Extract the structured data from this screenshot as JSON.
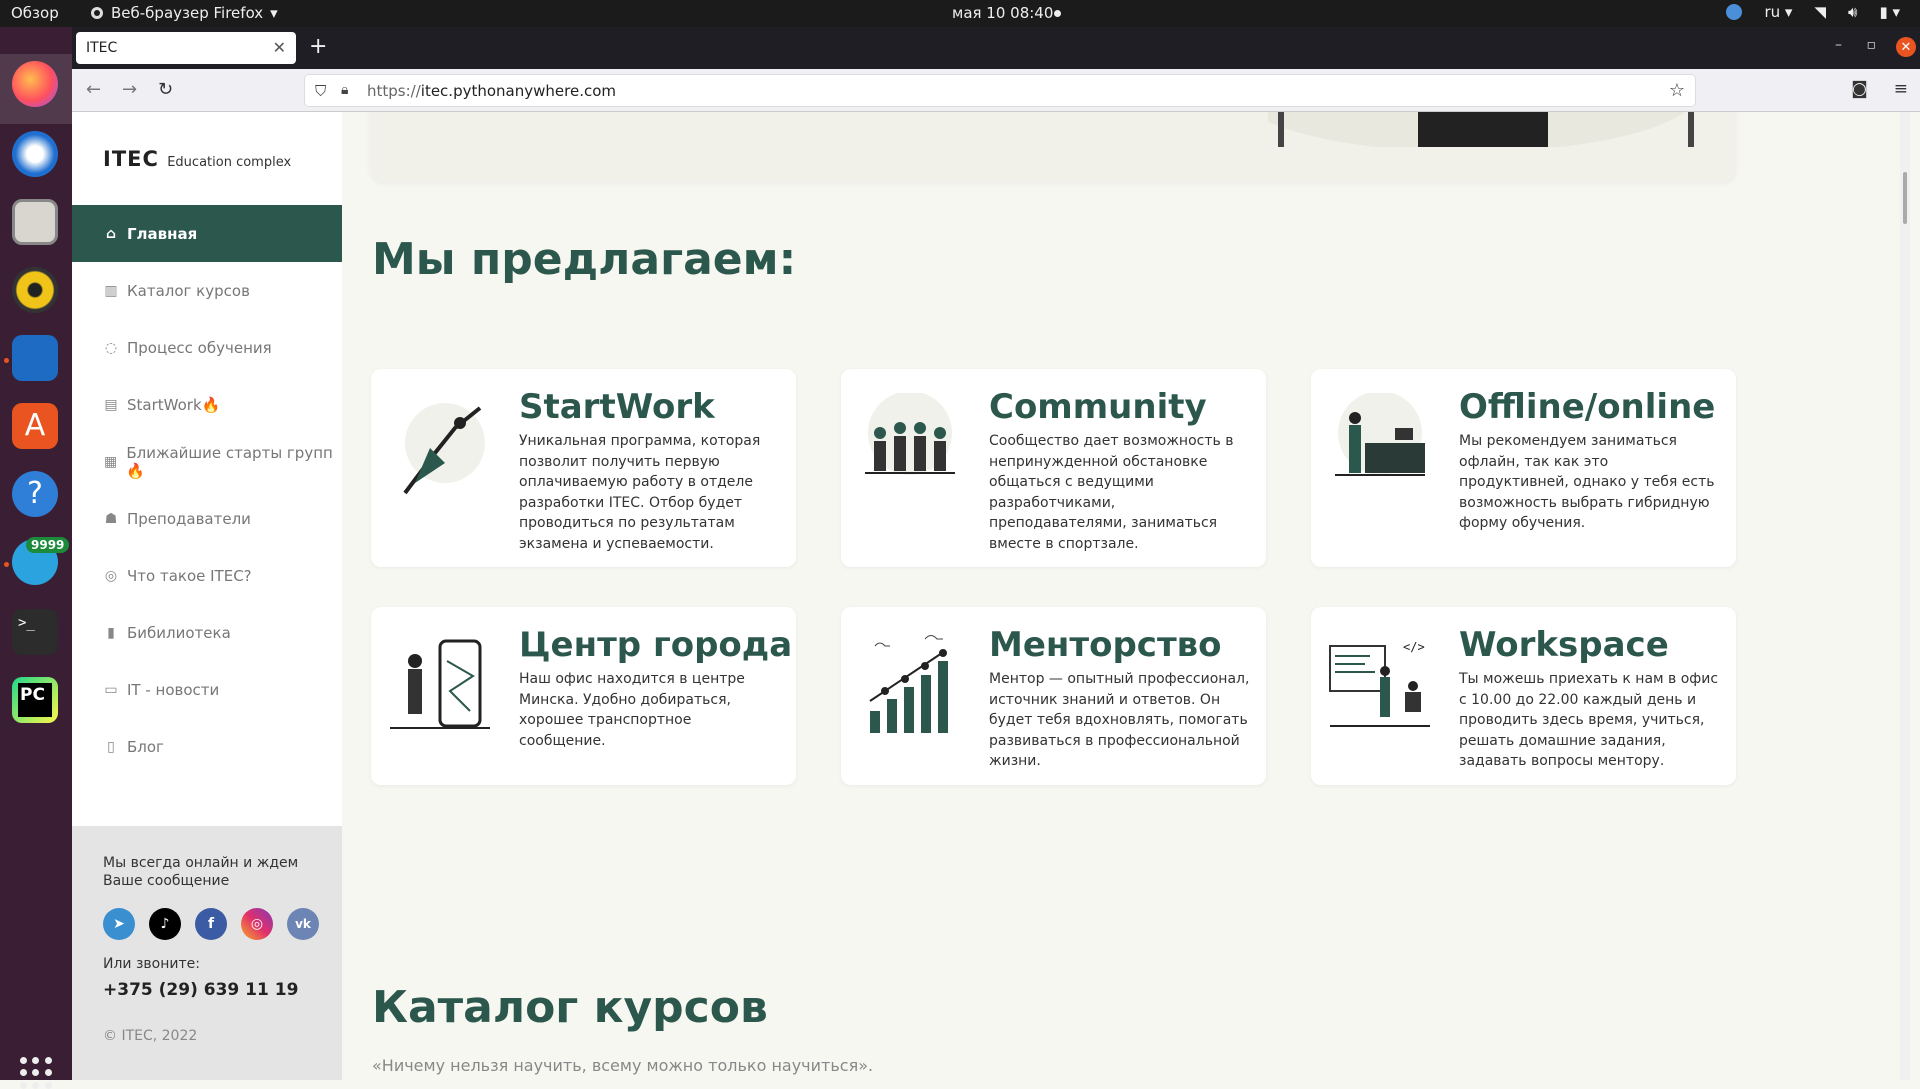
{
  "system": {
    "activities": "Обзор",
    "app_name": "Веб-браузер Firefox",
    "clock": "мая 10  08:40",
    "lang": "ru",
    "telegram_badge": "9999"
  },
  "browser": {
    "tab_title": "ITEC",
    "url_scheme": "https://",
    "url_host": "itec.pythonanywhere.com"
  },
  "sidebar": {
    "logo": "ITEC",
    "logo_sub": "Education complex",
    "items": [
      {
        "label": "Главная",
        "icon": "home-icon"
      },
      {
        "label": "Каталог курсов",
        "icon": "book-icon"
      },
      {
        "label": "Процесс обучения",
        "icon": "cycle-icon"
      },
      {
        "label": "StartWork🔥",
        "icon": "briefcase-icon"
      },
      {
        "label": "Ближайшие старты групп🔥",
        "icon": "calendar-icon"
      },
      {
        "label": "Преподаватели",
        "icon": "people-icon"
      },
      {
        "label": "Что такое ITEC?",
        "icon": "question-icon"
      },
      {
        "label": "Бибилиотека",
        "icon": "library-icon"
      },
      {
        "label": "IT - новости",
        "icon": "news-icon"
      },
      {
        "label": "Блог",
        "icon": "blog-icon"
      }
    ],
    "contact_text": "Мы всегда онлайн и ждем Ваше сообщение",
    "phone_label": "Или звоните:",
    "phone": "+375 (29) 639 11 19",
    "copyright": "© ITEC, 2022"
  },
  "main": {
    "offer_title": "Мы предлагаем:",
    "cards": [
      {
        "title": "StartWork",
        "text": "Уникальная программа, которая позволит получить первую оплачиваемую работу в отделе разработки ITEC. Отбор будет проводиться по результатам экзамена и успеваемости."
      },
      {
        "title": "Community",
        "text": "Сообщество дает возможность в непринужденной обстановке общаться с ведущими разработчиками, преподавателями, заниматься вместе в спортзале."
      },
      {
        "title": "Offline/online",
        "text": "Мы рекомендуем заниматься офлайн, так как это продуктивней, однако у тебя есть возможность выбрать гибридную форму обучения."
      },
      {
        "title": "Центр города",
        "text": "Наш офис находится в центре Минска. Удобно добираться, хорошее транспортное сообщение."
      },
      {
        "title": "Менторство",
        "text": "Ментор — опытный профессионал, источник знаний и ответов. Он будет тебя вдохновлять, помогать развиваться в профессиональной жизни."
      },
      {
        "title": "Workspace",
        "text": "Ты можешь приехать к нам в офис с 10.00 до 22.00 каждый день и проводить здесь время, учиться, решать домашние задания, задавать вопросы ментору."
      }
    ],
    "catalog_title": "Каталог курсов",
    "catalog_quote": "«Ничему нельзя научить, всему можно только научиться»."
  },
  "colors": {
    "accent": "#2c574c",
    "bg": "#f7f7f2"
  }
}
